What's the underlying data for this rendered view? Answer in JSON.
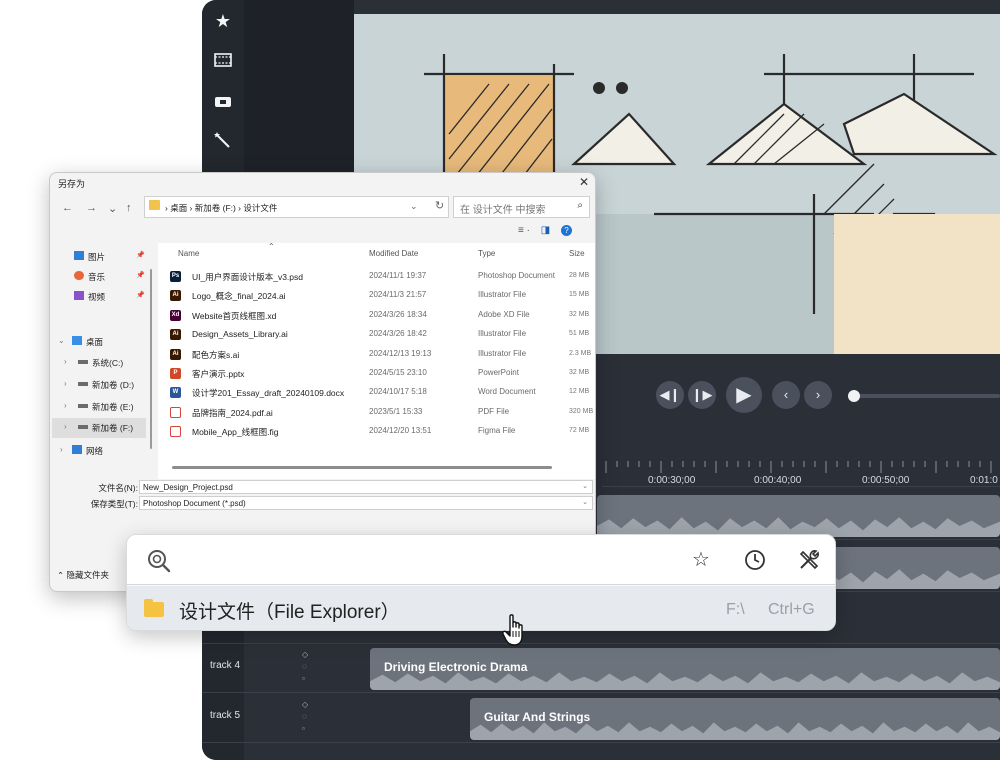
{
  "editor": {
    "transport": {
      "prev_frame_icon": "step-back-icon",
      "next_frame_icon": "step-forward-icon",
      "play_icon": "play-icon",
      "prev_icon": "chevron-left-icon",
      "next_icon": "chevron-right-icon"
    },
    "ruler_ticks": [
      "0:00:30;00",
      "0:00:40;00",
      "0:00:50;00",
      "0:01:0"
    ],
    "tracks": [
      {
        "label": "track 4",
        "clip": "Driving Electronic Drama"
      },
      {
        "label": "track 5",
        "clip": "Guitar And Strings"
      }
    ]
  },
  "dialog": {
    "title": "另存为",
    "close": "✕",
    "nav_back": "←",
    "nav_forward": "→",
    "nav_dropdown": "⌄",
    "nav_up": "↑",
    "address": "› 桌面 › 新加卷 (F:) › 设计文件",
    "search_placeholder": "在 设计文件 中搜索",
    "nav_pane": {
      "pinned": [
        {
          "label": "图片",
          "icon": "pictures-icon"
        },
        {
          "label": "音乐",
          "icon": "music-icon"
        },
        {
          "label": "视频",
          "icon": "videos-icon"
        }
      ],
      "desktop": "桌面",
      "drives": [
        "系统(C:)",
        "新加卷 (D:)",
        "新加卷 (E:)",
        "新加卷 (F:)"
      ],
      "network": "网络"
    },
    "columns": {
      "name": "Name",
      "modified": "Modified Date",
      "type": "Type",
      "size": "Size"
    },
    "files": [
      {
        "name": "UI_用户界面设计版本_v3.psd",
        "modified": "2024/11/1 19:37",
        "type": "Photoshop Document",
        "size": "28 MB",
        "badge": "Ps",
        "color": "#0a1d3b"
      },
      {
        "name": "Logo_概念_final_2024.ai",
        "modified": "2024/11/3 21:57",
        "type": "Illustrator File",
        "size": "15 MB",
        "badge": "Ai",
        "color": "#3a1800"
      },
      {
        "name": "Website首页线框图.xd",
        "modified": "2024/3/26 18:34",
        "type": "Adobe XD File",
        "size": "32 MB",
        "badge": "Xd",
        "color": "#470137"
      },
      {
        "name": "Design_Assets_Library.ai",
        "modified": "2024/3/26 18:42",
        "type": "Illustrator File",
        "size": "51 MB",
        "badge": "Ai",
        "color": "#3a1800"
      },
      {
        "name": "配色方案s.ai",
        "modified": "2024/12/13 19:13",
        "type": "Illustrator File",
        "size": "2.3 MB",
        "badge": "Ai",
        "color": "#3a1800"
      },
      {
        "name": "客户演示.pptx",
        "modified": "2024/5/15 23:10",
        "type": "PowerPoint",
        "size": "32 MB",
        "badge": "P",
        "color": "#d24726"
      },
      {
        "name": "设计学201_Essay_draft_20240109.docx",
        "modified": "2024/10/17 5:18",
        "type": "Word Document",
        "size": "12 MB",
        "badge": "W",
        "color": "#2b579a"
      },
      {
        "name": "品牌指南_2024.pdf.ai",
        "modified": "2023/5/1 15:33",
        "type": "PDF File",
        "size": "320 MB",
        "badge": "",
        "color": "#ffffff"
      },
      {
        "name": "Mobile_App_线框图.fig",
        "modified": "2024/12/20 13:51",
        "type": "Figma File",
        "size": "72 MB",
        "badge": "",
        "color": "#ffffff"
      }
    ],
    "filename_label": "文件名(N):",
    "filename_value": "New_Design_Project.psd",
    "filetype_label": "保存类型(T):",
    "filetype_value": "Photoshop Document (*.psd)",
    "hide_folders": "隐藏文件夹"
  },
  "launcher": {
    "search_value": "",
    "search_placeholder": "",
    "actions": [
      {
        "name": "favorite-button",
        "icon": "star-icon",
        "glyph": "☆"
      },
      {
        "name": "history-button",
        "icon": "clock-icon",
        "glyph": "◷"
      },
      {
        "name": "settings-button",
        "icon": "tools-icon",
        "glyph": "✂"
      }
    ],
    "result": {
      "name": "设计文件（File Explorer）",
      "path": "F:\\",
      "shortcut": "Ctrl+G"
    }
  }
}
